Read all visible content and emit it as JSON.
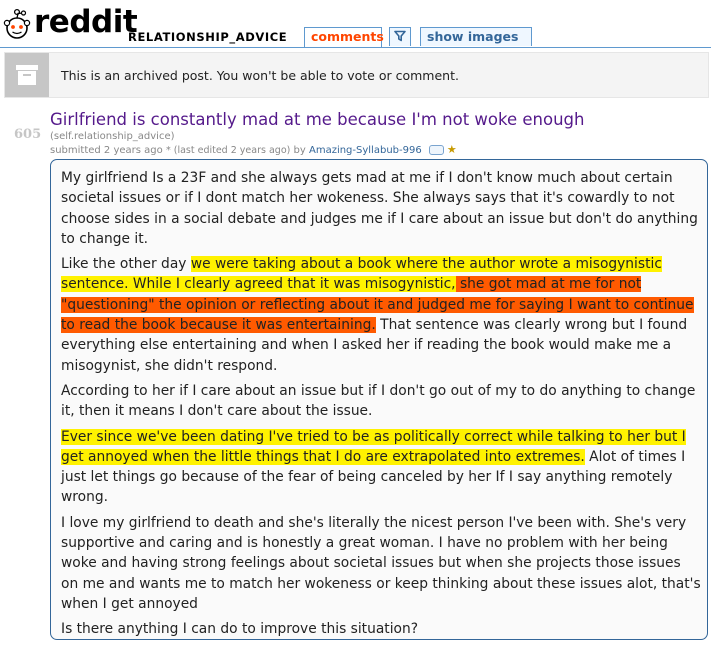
{
  "header": {
    "logo_text": "reddit",
    "subreddit": "RELATIONSHIP_ADVICE",
    "tabs": {
      "comments": "comments",
      "show_images": "show images"
    },
    "colors": {
      "accent": "#ff4500",
      "tab_border": "#5f99cf",
      "link": "#336699"
    }
  },
  "archived_notice": {
    "icon": "archive-box-icon",
    "text": "This is an archived post. You won't be able to vote or comment."
  },
  "post": {
    "score": "605",
    "title": "Girlfriend is constantly mad at me because I'm not woke enough",
    "domain": "(self.relationship_advice)",
    "tagline": {
      "submitted": "submitted 2 years ago",
      "edited": "* (last edited 2 years ago)",
      "by": "by",
      "author": "Amazing-Syllabub-996"
    },
    "icons": [
      "flair-icon",
      "trophy-icon"
    ],
    "body": {
      "p1": "My girlfriend Is a 23F and she always gets mad at me if I don't know much about certain societal issues or if I dont match her wokeness. She always says that it's cowardly to not choose sides in a social debate and judges me if I care about an issue but don't do anything to change it.",
      "p2": {
        "a": "Like the other day ",
        "b_highlight_yellow": "we were taking about a book where the author wrote a misogynistic sentence. While I clearly agreed that it was misogynistic,",
        "c_highlight_orange": " she got mad at me for not \"questioning\" the opinion or reflecting about it and judged me for saying I want to continue to read the book because it was entertaining.",
        "d": " That sentence was clearly wrong but I found everything else entertaining and when I asked her if reading the book would make me a misogynist, she didn't respond."
      },
      "p3": "According to her if I care about an issue but if I don't go out of my to do anything to change it, then it means I don't care about the issue.",
      "p4": {
        "a_highlight_yellow": "Ever since we've been dating I've tried to be as politically correct while talking to her but I get annoyed when the little things that I do are extrapolated into extremes.",
        "b": " Alot of times I just let things go because of the fear of being canceled by her If I say anything remotely wrong."
      },
      "p5": "I love my girlfriend to death and she's literally the nicest person I've been with. She's very supportive and caring and is honestly a great woman. I have no problem with her being woke and having strong feelings about societal issues but when she projects those issues on me and wants me to match her wokeness or keep thinking about these issues alot, that's when I get annoyed",
      "p6": "Is there anything I can do to improve this situation?"
    },
    "highlight_colors": {
      "yellow": "#fff200",
      "orange": "#ff5a00"
    }
  }
}
